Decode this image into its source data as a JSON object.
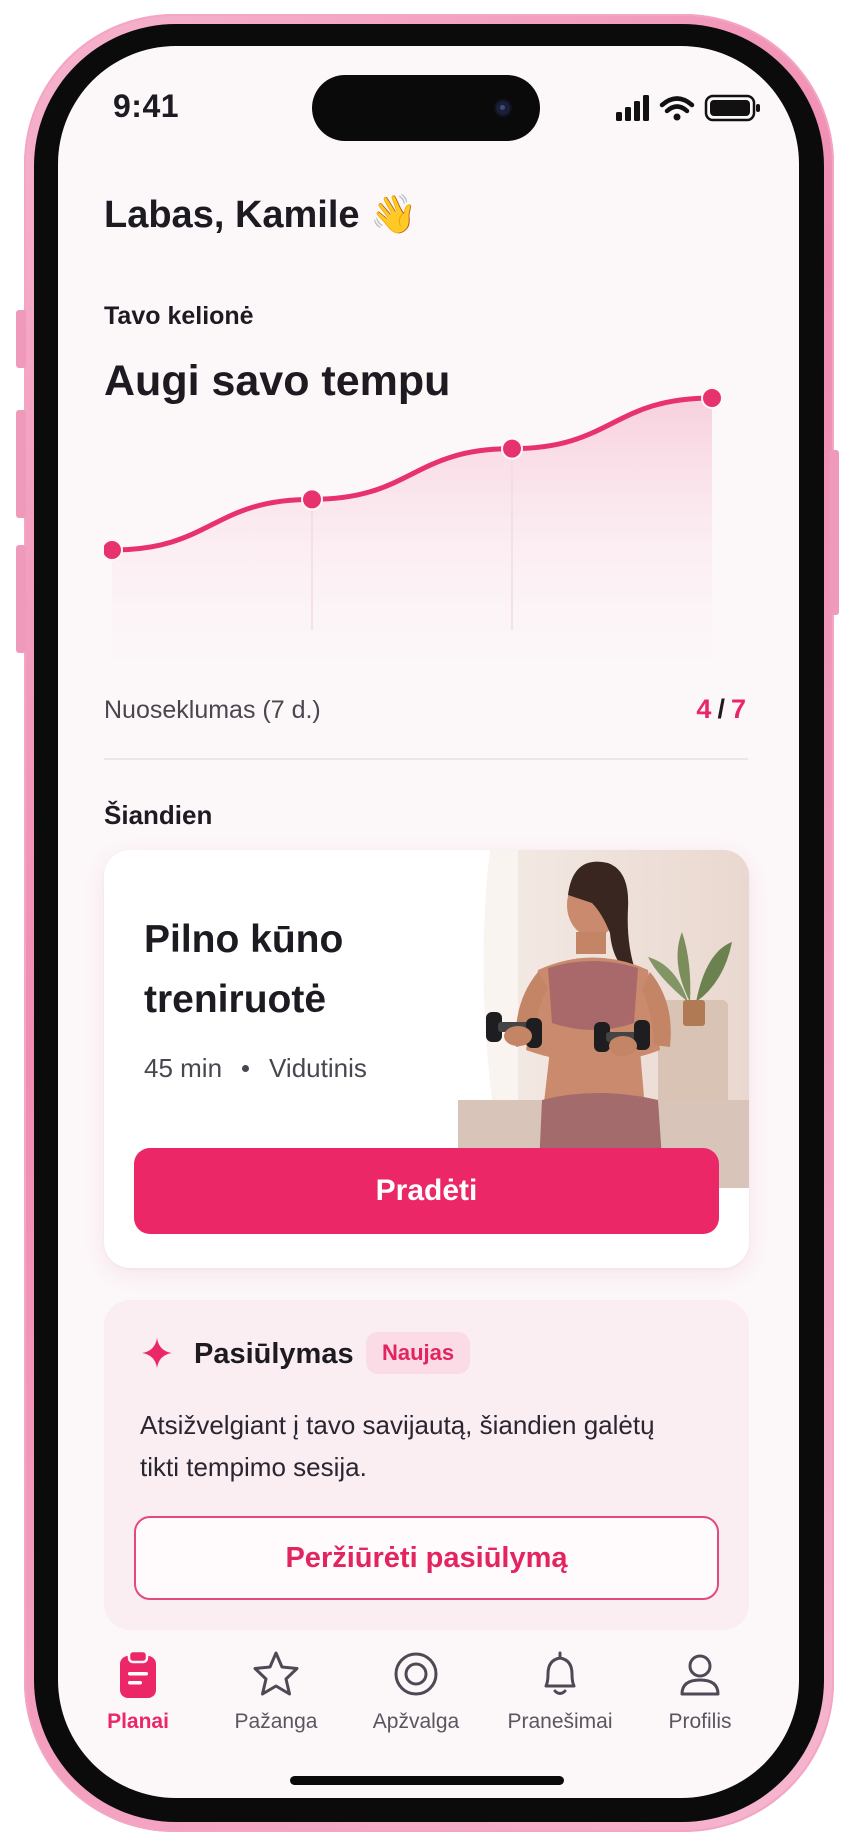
{
  "status_bar": {
    "time": "9:41",
    "icons": [
      "signal-icon",
      "wifi-icon",
      "battery-icon"
    ]
  },
  "header": {
    "greeting": "Labas, Kamile 👋"
  },
  "journey": {
    "label": "Tavo kelionė",
    "title": "Augi savo tempu",
    "consistency_label": "Nuoseklumas (7 d.)",
    "consistency_done": "4",
    "consistency_sep": "/",
    "consistency_total": "7"
  },
  "chart_data": {
    "type": "line",
    "x": [
      1,
      2,
      3,
      4
    ],
    "values": [
      1,
      2,
      3,
      4
    ],
    "title": "",
    "xlabel": "",
    "ylabel": "",
    "grid": false,
    "legend": "none",
    "color": "#e8326e"
  },
  "today": {
    "label": "Šiandien",
    "workout_title": "Pilno kūno treniruotė",
    "duration": "45 min",
    "level": "Vidutinis",
    "start_label": "Pradėti"
  },
  "suggestion": {
    "icon": "sparkle-icon",
    "title": "Pasiūlymas",
    "badge": "Naujas",
    "text": "Atsižvelgiant į tavo savijautą, šiandien galėtų tikti tempimo sesija.",
    "button_label": "Peržiūrėti pasiūlymą"
  },
  "tabs": [
    {
      "label": "Planai",
      "icon": "clipboard-icon",
      "active": true
    },
    {
      "label": "Pažanga",
      "icon": "star-icon",
      "active": false
    },
    {
      "label": "Apžvalga",
      "icon": "target-icon",
      "active": false
    },
    {
      "label": "Pranešimai",
      "icon": "bell-icon",
      "active": false
    },
    {
      "label": "Profilis",
      "icon": "user-icon",
      "active": false
    }
  ],
  "colors": {
    "accent": "#ec2767",
    "background": "#fcf7f9",
    "card": "#ffffff",
    "suggestion_bg": "#fbeef3"
  }
}
